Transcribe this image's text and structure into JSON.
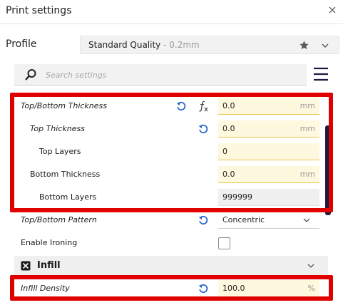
{
  "window": {
    "title": "Print settings"
  },
  "profile": {
    "label": "Profile",
    "name": "Standard Quality",
    "sub": "0.2mm"
  },
  "search": {
    "placeholder": "Search settings"
  },
  "settings": [
    {
      "label": "Top/Bottom Thickness",
      "value": "0.0",
      "unit": "mm"
    },
    {
      "label": "Top Thickness",
      "value": "0.0",
      "unit": "mm"
    },
    {
      "label": "Top Layers",
      "value": "0"
    },
    {
      "label": "Bottom Thickness",
      "value": "0.0",
      "unit": "mm"
    },
    {
      "label": "Bottom Layers",
      "value": "999999"
    },
    {
      "label": "Top/Bottom Pattern",
      "value": "Concentric"
    },
    {
      "label": "Enable Ironing",
      "checked": false
    }
  ],
  "infill": {
    "category": "Infill",
    "density": {
      "label": "Infill Density",
      "value": "100.0",
      "unit": "%"
    }
  },
  "colors": {
    "highlight": "#e00000",
    "reset_icon": "#1f60c8",
    "modified_field": "#fdf8de",
    "scrollbar": "#1c1c40"
  }
}
